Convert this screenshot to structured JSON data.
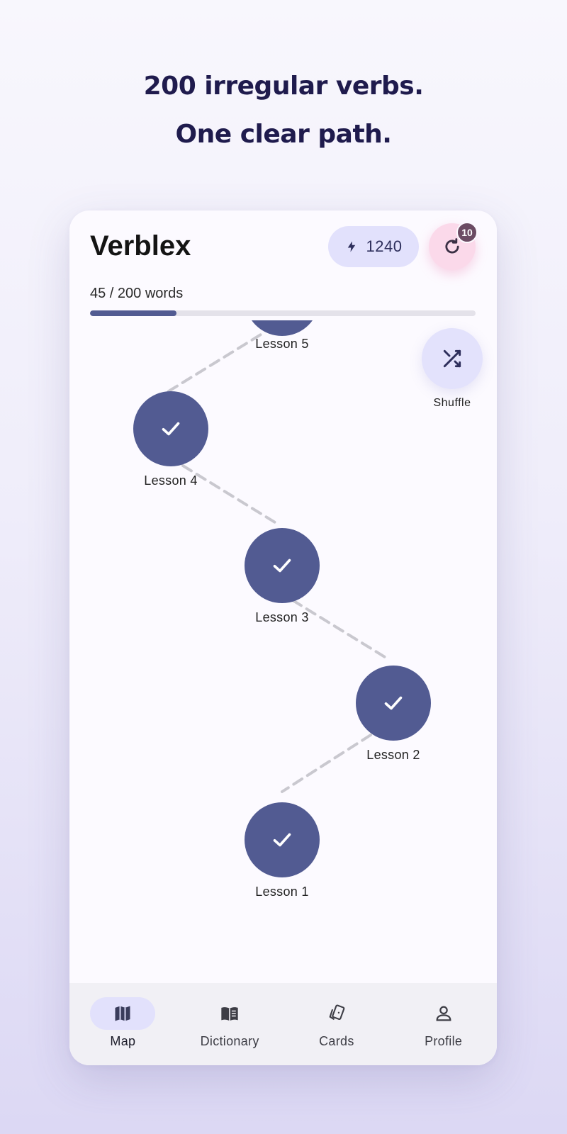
{
  "headline": {
    "line1": "200 irregular verbs.",
    "line2": "One clear path."
  },
  "header": {
    "app_title": "Verblex",
    "xp_value": "1240",
    "xp_icon": "lightning-bolt-icon",
    "review_icon": "refresh-icon",
    "review_badge": "10"
  },
  "progress": {
    "label": "45 / 200 words",
    "learned": 45,
    "total": 200
  },
  "map": {
    "lessons": [
      {
        "label": "Lesson 5",
        "completed": true
      },
      {
        "label": "Lesson 4",
        "completed": true
      },
      {
        "label": "Lesson 3",
        "completed": true
      },
      {
        "label": "Lesson 2",
        "completed": true
      },
      {
        "label": "Lesson 1",
        "completed": true
      }
    ],
    "shuffle_label": "Shuffle",
    "shuffle_icon": "shuffle-icon"
  },
  "nav": {
    "items": [
      {
        "label": "Map",
        "icon": "map-icon",
        "active": true
      },
      {
        "label": "Dictionary",
        "icon": "book-icon",
        "active": false
      },
      {
        "label": "Cards",
        "icon": "cards-icon",
        "active": false
      },
      {
        "label": "Profile",
        "icon": "person-icon",
        "active": false
      }
    ]
  },
  "colors": {
    "node": "#525b92",
    "accent_soft": "#e2e1fc",
    "review_bg": "#fbd9ea",
    "badge": "#6b4b63",
    "headline": "#1f1b4d"
  }
}
